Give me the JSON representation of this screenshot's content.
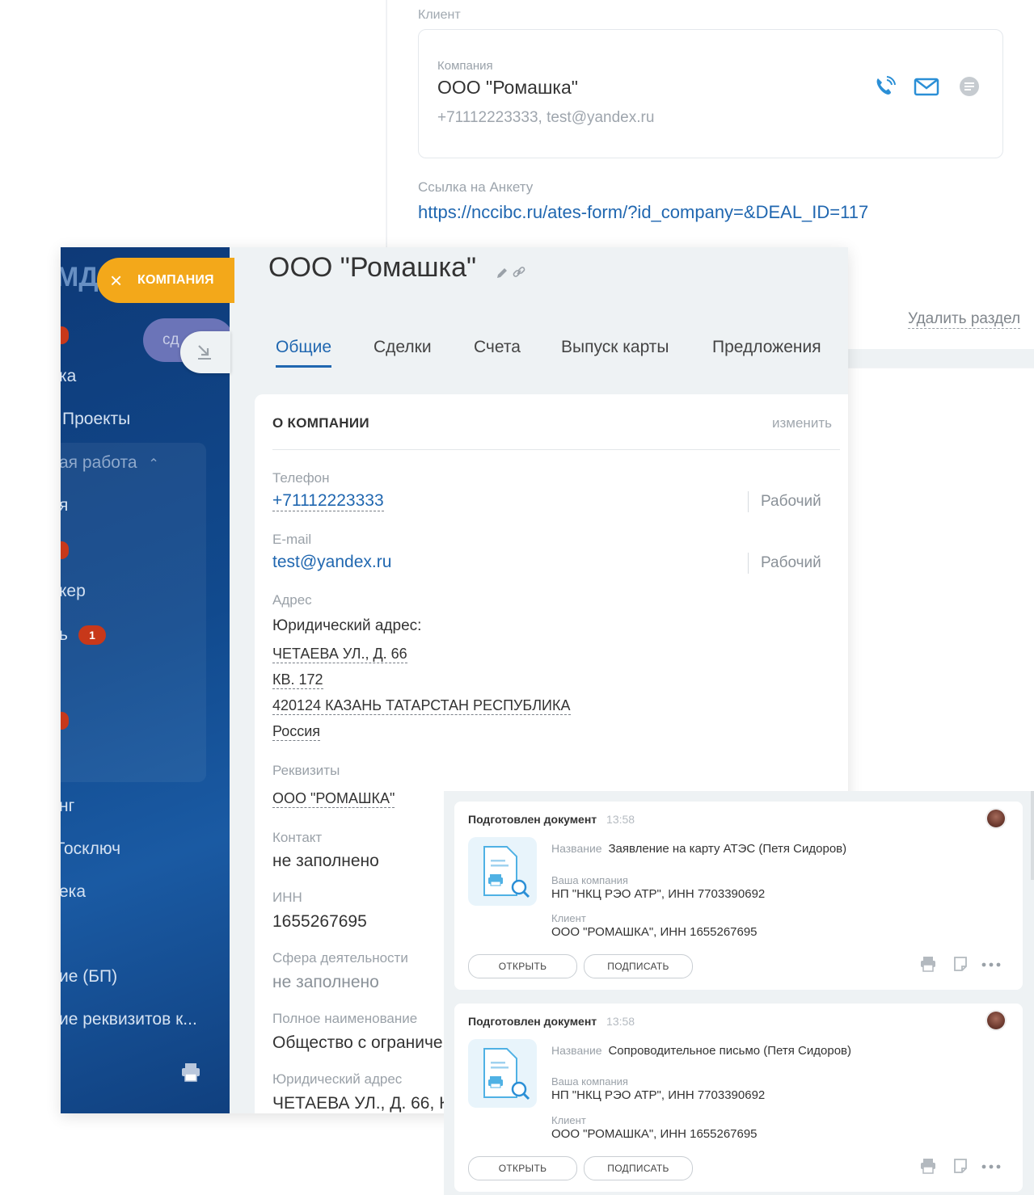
{
  "client_panel": {
    "section_label": "Клиент",
    "company_label": "Компания",
    "company_name": "ООО \"Ромашка\"",
    "contacts": "+71112223333, test@yandex.ru",
    "link_label": "Ссылка на Анкету",
    "link_url": "https://nccibc.ru/ates-form/?id_company=&DEAL_ID=117",
    "delete_label": "Удалить раздел"
  },
  "sidebar": {
    "logo_fragment": "МД",
    "pill_label": "сд",
    "items": [
      "ка",
      "Проекты",
      "ая работа",
      "я",
      "кер",
      "ь",
      "нг",
      "Госключ",
      "ека",
      "ие (БП)",
      "ие реквизитов к..."
    ],
    "badge": "1"
  },
  "entity_tag": "КОМПАНИЯ",
  "company": {
    "title": "ООО \"Ромашка\"",
    "tabs": [
      "Общие",
      "Сделки",
      "Счета",
      "Выпуск карты",
      "Предложения"
    ],
    "section_title": "О КОМПАНИИ",
    "edit_label": "изменить",
    "phone_label": "Телефон",
    "phone": "+71112223333",
    "phone_type": "Рабочий",
    "email_label": "E-mail",
    "email": "test@yandex.ru",
    "email_type": "Рабочий",
    "address_label": "Адрес",
    "address_sublabel": "Юридический адрес:",
    "address_lines": [
      "ЧЕТАЕВА УЛ., Д. 66",
      "КВ. 172",
      "420124 КАЗАНЬ ТАТАРСТАН РЕСПУБЛИКА",
      "Россия"
    ],
    "requisites_label": "Реквизиты",
    "requisites": "ООО \"РОМАШКА\"",
    "contact_label": "Контакт",
    "contact": "не заполнено",
    "inn_label": "ИНН",
    "inn": "1655267695",
    "sphere_label": "Сфера деятельности",
    "sphere": "не заполнено",
    "fullname_label": "Полное наименование",
    "fullname": "Общество с ограниче",
    "legal_address_label": "Юридический адрес",
    "legal_address": "ЧЕТАЕВА УЛ., Д. 66, К"
  },
  "documents": [
    {
      "header": "Подготовлен документ",
      "time": "13:58",
      "name_label": "Название",
      "name": "Заявление на карту АТЭС (Петя Сидоров)",
      "your_company_label": "Ваша компания",
      "your_company": "НП \"НКЦ РЭО АТР\", ИНН 7703390692",
      "client_label": "Клиент",
      "client": "ООО \"РОМАШКА\", ИНН 1655267695",
      "open_label": "ОТКРЫТЬ",
      "sign_label": "ПОДПИСАТЬ"
    },
    {
      "header": "Подготовлен документ",
      "time": "13:58",
      "name_label": "Название",
      "name": "Сопроводительное письмо (Петя Сидоров)",
      "your_company_label": "Ваша компания",
      "your_company": "НП \"НКЦ РЭО АТР\", ИНН 7703390692",
      "client_label": "Клиент",
      "client": "ООО \"РОМАШКА\", ИНН 1655267695",
      "open_label": "ОТКРЫТЬ",
      "sign_label": "ПОДПИСАТЬ"
    }
  ],
  "colors": {
    "accent_blue": "#2067b0",
    "entity_tag": "#f3a81a",
    "sidebar": "#114a8e",
    "badge": "#c8381a"
  }
}
